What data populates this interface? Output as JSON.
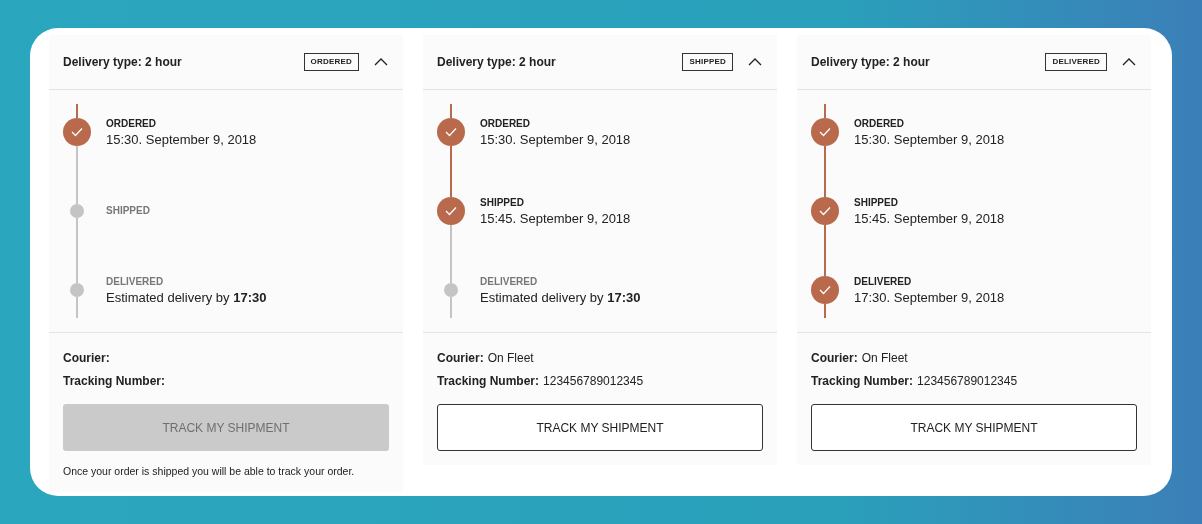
{
  "cards": [
    {
      "title": "Delivery type: 2 hour",
      "badge": "ORDERED",
      "expanded": true,
      "steps": [
        {
          "label": "ORDERED",
          "detail": "15:30. September 9, 2018",
          "done": true
        },
        {
          "label": "SHIPPED",
          "done": false
        },
        {
          "label": "DELIVERED",
          "detail": "Estimated delivery by **17:30**",
          "done": false
        }
      ],
      "courier_label": "Courier:",
      "tracking_label": "Tracking Number:",
      "button": {
        "label": "TRACK MY SHIPMENT",
        "disabled": true
      },
      "note": "Once your order is shipped you will be able to track your order."
    },
    {
      "title": "Delivery type: 2 hour",
      "badge": "SHIPPED",
      "expanded": true,
      "steps": [
        {
          "label": "ORDERED",
          "detail": "15:30. September 9, 2018",
          "done": true
        },
        {
          "label": "SHIPPED",
          "detail": "15:45. September 9, 2018",
          "done": true
        },
        {
          "label": "DELIVERED",
          "detail": "Estimated delivery by **17:30**",
          "done": false
        }
      ],
      "courier_label": "Courier:",
      "courier": "On Fleet",
      "tracking_label": "Tracking Number:",
      "tracking": "123456789012345",
      "button": {
        "label": "TRACK MY SHIPMENT",
        "disabled": false
      }
    },
    {
      "title": "Delivery type: 2 hour",
      "badge": "DELIVERED",
      "expanded": true,
      "steps": [
        {
          "label": "ORDERED",
          "detail": "15:30. September 9, 2018",
          "done": true
        },
        {
          "label": "SHIPPED",
          "detail": "15:45. September 9, 2018",
          "done": true
        },
        {
          "label": "DELIVERED",
          "detail": "17:30. September 9, 2018",
          "done": true
        }
      ],
      "courier_label": "Courier:",
      "courier": "On Fleet",
      "tracking_label": "Tracking Number:",
      "tracking": "123456789012345",
      "button": {
        "label": "TRACK MY SHIPMENT",
        "disabled": false
      }
    }
  ]
}
